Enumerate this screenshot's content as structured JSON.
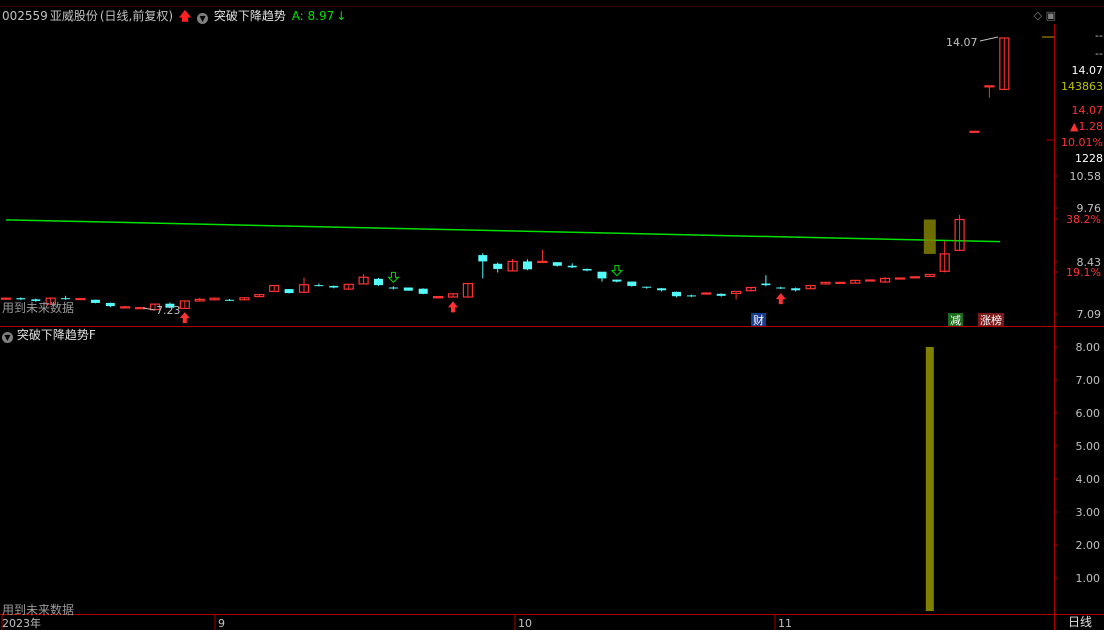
{
  "header": {
    "stock_code": "002559",
    "stock_name": "亚威股份",
    "period_info": "(日线,前复权)",
    "indicator_name": "突破下降趋势",
    "indicator_value": "A: 8.97",
    "down_arrow": "↓"
  },
  "right_panel": {
    "dash1": "--",
    "dash2": "--",
    "price": "14.07",
    "volume": "143863",
    "price2": "14.07",
    "change": "▲1.28",
    "change_pct": "10.01%",
    "amount": "1228"
  },
  "price_axis": {
    "labels": [
      "10.58",
      "9.76",
      "38.2%",
      "8.43",
      "19.1%",
      "7.09"
    ]
  },
  "indicator_axis": {
    "labels": [
      "8.00",
      "7.00",
      "6.00",
      "5.00",
      "4.00",
      "3.00",
      "2.00",
      "1.00"
    ]
  },
  "annotations": {
    "high_label": "14.07",
    "low_label": "7.23",
    "cai": "财",
    "jian": "减",
    "zhangbang": "涨榜"
  },
  "pane2": {
    "title": "突破下降趋势F"
  },
  "no_future_text": "用到未来数据",
  "time_axis": {
    "labels": [
      "2023年",
      "9",
      "10",
      "11"
    ]
  },
  "bottom_right": "日线",
  "colors": {
    "up": "#ff3232",
    "down": "#54fcfc",
    "trend_line": "#00e000",
    "bar": "#808000",
    "grid": "#aa0000"
  },
  "chart_data": {
    "type": "candlestick",
    "trend_line": [
      9.47,
      8.92
    ],
    "candles": [
      [
        7.47,
        7.51,
        7.45,
        7.49
      ],
      [
        7.49,
        7.51,
        7.44,
        7.46
      ],
      [
        7.46,
        7.48,
        7.4,
        7.42
      ],
      [
        7.34,
        7.51,
        7.32,
        7.49
      ],
      [
        7.49,
        7.55,
        7.45,
        7.47
      ],
      [
        7.47,
        7.49,
        7.45,
        7.48
      ],
      [
        7.45,
        7.45,
        7.36,
        7.37
      ],
      [
        7.37,
        7.38,
        7.26,
        7.29
      ],
      [
        7.27,
        7.3,
        7.24,
        7.27
      ],
      [
        7.24,
        7.27,
        7.23,
        7.25
      ],
      [
        7.2,
        7.33,
        7.21,
        7.34
      ],
      [
        7.35,
        7.38,
        7.24,
        7.25
      ],
      [
        7.23,
        7.43,
        7.24,
        7.42
      ],
      [
        7.42,
        7.5,
        7.41,
        7.46
      ],
      [
        7.45,
        7.5,
        7.44,
        7.49
      ],
      [
        7.45,
        7.47,
        7.42,
        7.44
      ],
      [
        7.45,
        7.51,
        7.45,
        7.5
      ],
      [
        7.53,
        7.59,
        7.52,
        7.58
      ],
      [
        7.66,
        7.82,
        7.65,
        7.81
      ],
      [
        7.72,
        7.72,
        7.61,
        7.62
      ],
      [
        7.64,
        8.01,
        7.63,
        7.83
      ],
      [
        7.82,
        7.86,
        7.79,
        7.81
      ],
      [
        7.8,
        7.81,
        7.74,
        7.76
      ],
      [
        7.72,
        7.85,
        7.7,
        7.84
      ],
      [
        7.85,
        8.1,
        7.85,
        8.02
      ],
      [
        7.98,
        8.0,
        7.8,
        7.82
      ],
      [
        7.76,
        7.79,
        7.71,
        7.74
      ],
      [
        7.76,
        7.76,
        7.68,
        7.68
      ],
      [
        7.73,
        7.74,
        7.59,
        7.6
      ],
      [
        7.5,
        7.55,
        7.48,
        7.53
      ],
      [
        7.52,
        7.61,
        7.51,
        7.6
      ],
      [
        7.52,
        7.86,
        7.52,
        7.86
      ],
      [
        8.58,
        8.63,
        7.99,
        8.42
      ],
      [
        8.36,
        8.39,
        8.14,
        8.23
      ],
      [
        8.18,
        8.48,
        8.17,
        8.42
      ],
      [
        8.42,
        8.47,
        8.2,
        8.22
      ],
      [
        8.42,
        8.71,
        8.4,
        8.42
      ],
      [
        8.4,
        8.4,
        8.29,
        8.31
      ],
      [
        8.31,
        8.37,
        8.25,
        8.27
      ],
      [
        8.23,
        8.24,
        8.17,
        8.19
      ],
      [
        8.16,
        8.15,
        7.91,
        7.99
      ],
      [
        7.96,
        7.96,
        7.89,
        7.91
      ],
      [
        7.91,
        7.91,
        7.78,
        7.8
      ],
      [
        7.78,
        7.78,
        7.73,
        7.76
      ],
      [
        7.74,
        7.75,
        7.66,
        7.69
      ],
      [
        7.65,
        7.66,
        7.51,
        7.54
      ],
      [
        7.56,
        7.58,
        7.52,
        7.55
      ],
      [
        7.61,
        7.64,
        7.58,
        7.62
      ],
      [
        7.6,
        7.61,
        7.53,
        7.55
      ],
      [
        7.61,
        7.63,
        7.46,
        7.66
      ],
      [
        7.68,
        7.77,
        7.66,
        7.76
      ],
      [
        7.86,
        8.07,
        7.79,
        7.82
      ],
      [
        7.76,
        7.78,
        7.72,
        7.74
      ],
      [
        7.74,
        7.76,
        7.66,
        7.69
      ],
      [
        7.73,
        7.82,
        7.72,
        7.81
      ],
      [
        7.85,
        7.9,
        7.84,
        7.89
      ],
      [
        7.87,
        7.9,
        7.86,
        7.89
      ],
      [
        7.87,
        7.95,
        7.88,
        7.94
      ],
      [
        7.94,
        7.96,
        7.92,
        7.95
      ],
      [
        7.9,
        8.02,
        7.88,
        7.99
      ],
      [
        8.0,
        8.01,
        7.97,
        8.0
      ],
      [
        8.02,
        8.05,
        7.99,
        8.03
      ],
      [
        8.04,
        8.1,
        8.03,
        8.09
      ],
      [
        8.17,
        8.93,
        8.14,
        8.61
      ],
      [
        8.7,
        9.6,
        8.68,
        9.48
      ],
      [
        11.71,
        11.71,
        11.69,
        11.71
      ],
      [
        12.86,
        12.86,
        12.56,
        12.86
      ],
      [
        12.77,
        14.07,
        12.75,
        14.07
      ]
    ],
    "buy_arrows": [
      12,
      30,
      52
    ],
    "hollow_down_arrows": [
      26,
      41
    ],
    "bar_value": 8.0,
    "bar_index": 62,
    "y_axis_ticks": [
      7.09,
      8.43,
      9.76,
      10.58
    ]
  }
}
